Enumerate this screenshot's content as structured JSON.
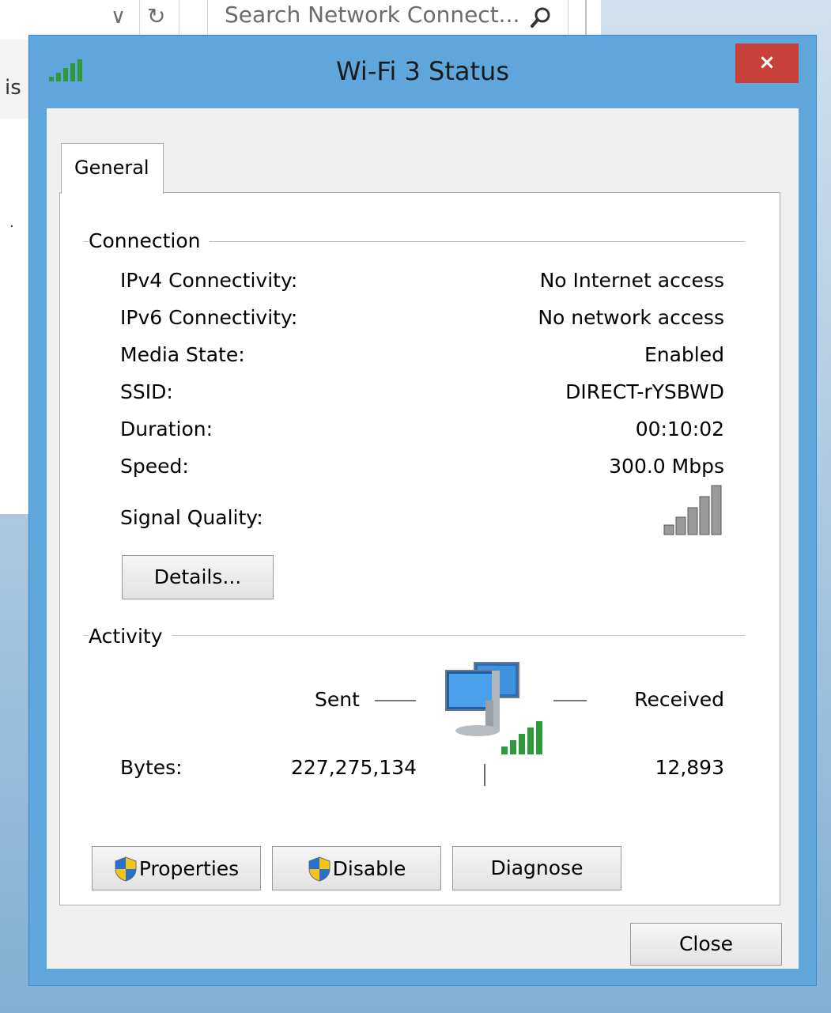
{
  "background": {
    "search_placeholder": "Search Network Connect...",
    "left_text": "is",
    "left_dot": "·"
  },
  "window": {
    "title": "Wi-Fi 3 Status",
    "close_glyph": "×",
    "tab_general": "General"
  },
  "connection": {
    "header": "Connection",
    "rows": [
      {
        "label": "IPv4 Connectivity:",
        "value": "No Internet access"
      },
      {
        "label": "IPv6 Connectivity:",
        "value": "No network access"
      },
      {
        "label": "Media State:",
        "value": "Enabled"
      },
      {
        "label": "SSID:",
        "value": "DIRECT-rYSBWD"
      },
      {
        "label": "Duration:",
        "value": "00:10:02"
      },
      {
        "label": "Speed:",
        "value": "300.0 Mbps"
      }
    ],
    "signal_label": "Signal Quality:",
    "signal_bars_filled": 0,
    "details_button": "Details..."
  },
  "activity": {
    "header": "Activity",
    "sent_label": "Sent",
    "received_label": "Received",
    "bytes_label": "Bytes:",
    "bytes_sent": "227,275,134",
    "bytes_received": "12,893"
  },
  "buttons": {
    "properties": "Properties",
    "disable": "Disable",
    "diagnose": "Diagnose",
    "close": "Close"
  },
  "colors": {
    "window_frame": "#5ea6dc",
    "close_red": "#c7403a",
    "signal_green": "#2f9a3a"
  }
}
